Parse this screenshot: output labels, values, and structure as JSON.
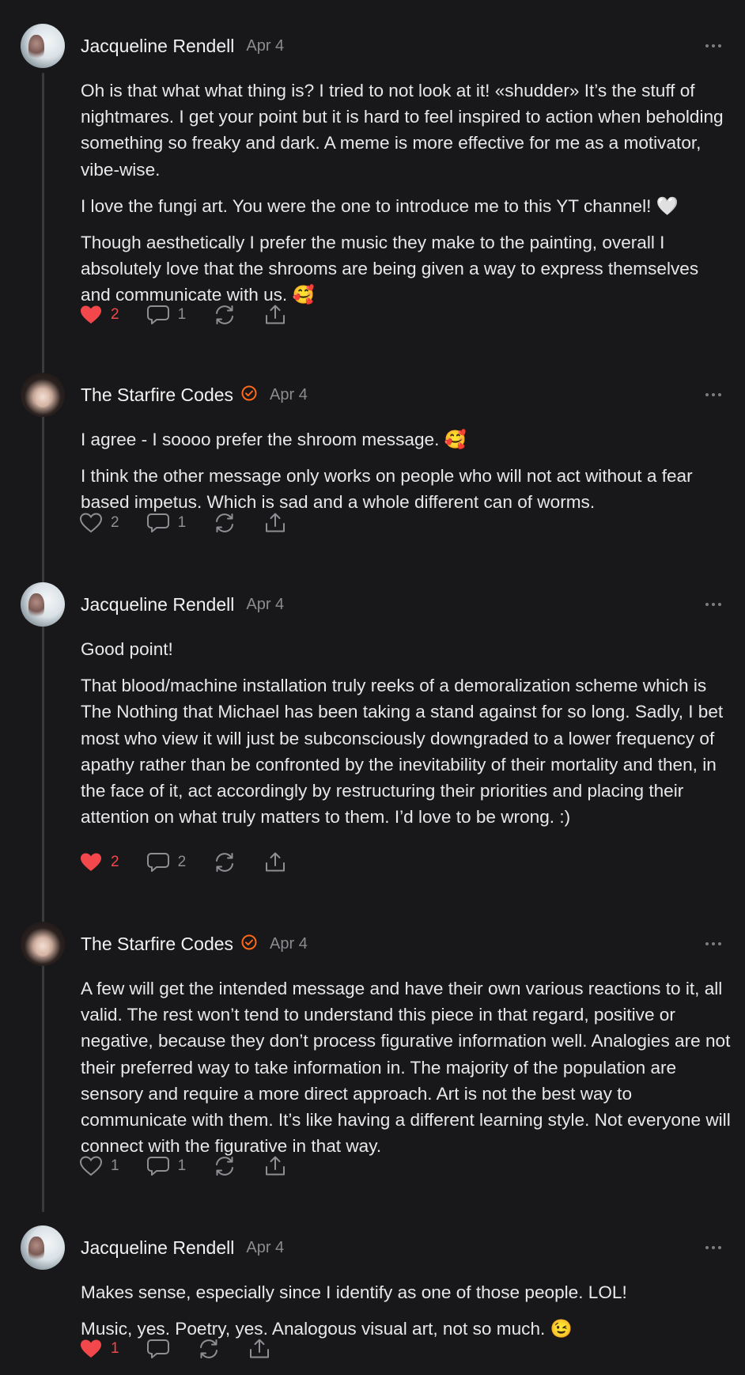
{
  "accent_color": "#f2474b",
  "verified_color": "#ff6719",
  "comments": [
    {
      "author": "Jacqueline Rendell",
      "verified": false,
      "avatar": "portrait-light",
      "date": "Apr 4",
      "paragraphs": [
        "Oh is that what what thing is? I tried to not look at it! «shudder» It’s the stuff of nightmares. I get your point but it is hard to feel inspired to action when beholding something so freaky and dark. A meme is more effective for me as a motivator, vibe-wise.",
        "I love the fungi art. You were the one to introduce me to this YT channel! 🤍",
        "Though aesthetically I prefer the music they make to the painting, overall I absolutely love that the shrooms are being given a way to express themselves and communicate with us. 🥰"
      ],
      "liked": true,
      "likes": "2",
      "replies": "1"
    },
    {
      "author": "The Starfire Codes",
      "verified": true,
      "avatar": "portrait-dark",
      "date": "Apr 4",
      "paragraphs": [
        "I agree - I soooo prefer the shroom message. 🥰",
        "I think the other message only works on people who will not act without a fear based impetus. Which is sad and a whole different can of worms."
      ],
      "liked": false,
      "likes": "2",
      "replies": "1"
    },
    {
      "author": "Jacqueline Rendell",
      "verified": false,
      "avatar": "portrait-light",
      "date": "Apr 4",
      "paragraphs": [
        "Good point!",
        "That blood/machine installation truly reeks of a demoralization scheme which is The Nothing that Michael has been taking a stand against for so long. Sadly, I bet most who view it will just be subconsciously downgraded to a lower frequency of apathy rather than be confronted by the inevitability of their mortality and then, in the face of it, act accordingly by restructuring their priorities and placing their attention on what truly matters to them. I’d love to be wrong. :)"
      ],
      "liked": true,
      "likes": "2",
      "replies": "2"
    },
    {
      "author": "The Starfire Codes",
      "verified": true,
      "avatar": "portrait-dark",
      "date": "Apr 4",
      "paragraphs": [
        "A few will get the intended message and have their own various reactions to it, all valid. The rest won’t tend to understand this piece in that regard, positive or negative, because they don’t process figurative information well. Analogies are not their preferred way to take information in. The majority of the population are sensory and require a more direct approach. Art is not the best way to communicate with them. It’s like having a different learning style. Not everyone will connect with the figurative in that way."
      ],
      "liked": false,
      "likes": "1",
      "replies": "1"
    },
    {
      "author": "Jacqueline Rendell",
      "verified": false,
      "avatar": "portrait-light",
      "date": "Apr 4",
      "paragraphs": [
        "Makes sense, especially since I identify as one of those people. LOL!",
        "Music, yes. Poetry, yes. Analogous visual art, not so much. 😉"
      ],
      "liked": true,
      "likes": "1",
      "replies": ""
    }
  ]
}
